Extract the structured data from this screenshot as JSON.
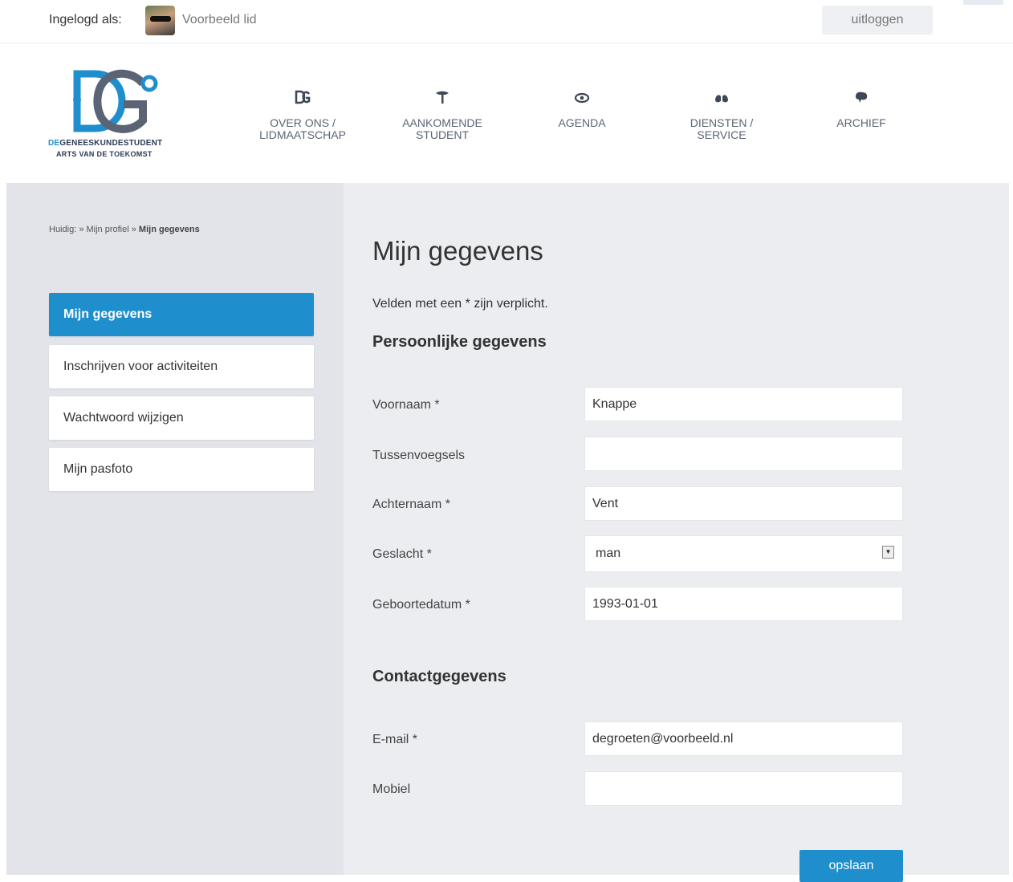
{
  "topbar": {
    "login_label": "Ingelogd als:",
    "username": "Voorbeeld lid",
    "logout_label": "uitloggen"
  },
  "logo": {
    "brand_prefix": "DE",
    "brand_rest": "GENEESKUNDESTUDENT",
    "tagline": "ARTS VAN DE TOEKOMST"
  },
  "nav": [
    {
      "label": "OVER ONS /\nLIDMAATSCHAP",
      "icon": "ds-logo-icon"
    },
    {
      "label": "AANKOMENDE\nSTUDENT",
      "icon": "caduceus-icon"
    },
    {
      "label": "AGENDA",
      "icon": "eye-icon"
    },
    {
      "label": "DIENSTEN /\nSERVICE",
      "icon": "lungs-icon"
    },
    {
      "label": "ARCHIEF",
      "icon": "brain-icon"
    }
  ],
  "breadcrumb": {
    "prefix": "Huidig:",
    "parent": "» Mijn profiel »",
    "current": "Mijn gegevens"
  },
  "sidebar": {
    "items": [
      {
        "label": "Mijn gegevens",
        "active": true
      },
      {
        "label": "Inschrijven voor activiteiten",
        "active": false
      },
      {
        "label": "Wachtwoord wijzigen",
        "active": false
      },
      {
        "label": "Mijn pasfoto",
        "active": false
      }
    ]
  },
  "main": {
    "title": "Mijn gegevens",
    "required_note": "Velden met een * zijn verplicht.",
    "personal_title": "Persoonlijke gegevens",
    "contact_title": "Contactgegevens",
    "fields": {
      "firstname": {
        "label": "Voornaam *",
        "value": "Knappe"
      },
      "infix": {
        "label": "Tussenvoegsels",
        "value": ""
      },
      "lastname": {
        "label": "Achternaam *",
        "value": "Vent"
      },
      "gender": {
        "label": "Geslacht *",
        "value": "man"
      },
      "birthdate": {
        "label": "Geboortedatum *",
        "value": "1993-01-01"
      },
      "email": {
        "label": "E-mail *",
        "value": "degroeten@voorbeeld.nl"
      },
      "mobile": {
        "label": "Mobiel",
        "value": ""
      }
    },
    "save_label": "opslaan"
  },
  "colors": {
    "accent": "#1f8ecd",
    "sidebar_bg": "#e2e4e9",
    "content_bg": "#ebedf0"
  }
}
